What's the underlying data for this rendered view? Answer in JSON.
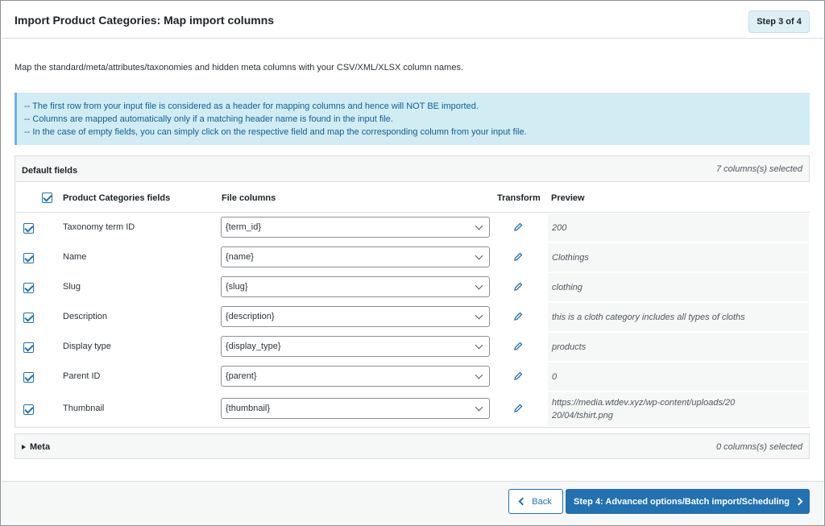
{
  "header": {
    "title": "Import Product Categories: Map import columns",
    "step": "Step 3 of 4"
  },
  "description": "Map the standard/meta/attributes/taxonomies and hidden meta columns with your CSV/XML/XLSX column names.",
  "notice": {
    "lines": [
      "-- The first row from your input file is considered as a header for mapping columns and hence will NOT BE imported.",
      "-- Columns are mapped automatically only if a matching header name is found in the input file.",
      "-- In the case of empty fields, you can simply click on the respective field and map the corresponding column from your input file."
    ]
  },
  "default_fields": {
    "title": "Default fields",
    "count": "7 columns(s) selected",
    "columns": {
      "fields": "Product Categories fields",
      "file_columns": "File columns",
      "transform": "Transform",
      "preview": "Preview"
    },
    "rows": [
      {
        "label": "Taxonomy term ID",
        "column": "{term_id}",
        "preview": "200"
      },
      {
        "label": "Name",
        "column": "{name}",
        "preview": "Clothings"
      },
      {
        "label": "Slug",
        "column": "{slug}",
        "preview": "clothing"
      },
      {
        "label": "Description",
        "column": "{description}",
        "preview": "this is a cloth category includes all types of cloths"
      },
      {
        "label": "Display type",
        "column": "{display_type}",
        "preview": "products"
      },
      {
        "label": "Parent ID",
        "column": "{parent}",
        "preview": "0"
      },
      {
        "label": "Thumbnail",
        "column": "{thumbnail}",
        "preview": "https://media.wtdev.xyz/wp-content/uploads/2020/04/tshirt.png"
      }
    ]
  },
  "meta": {
    "title": "Meta",
    "count": "0 columns(s) selected"
  },
  "footer": {
    "back": "Back",
    "next": "Step 4: Advanced options/Batch import/Scheduling"
  },
  "colors": {
    "primary": "#2271b1",
    "notice_bg": "#d1ecf3",
    "notice_text": "#135e96"
  }
}
